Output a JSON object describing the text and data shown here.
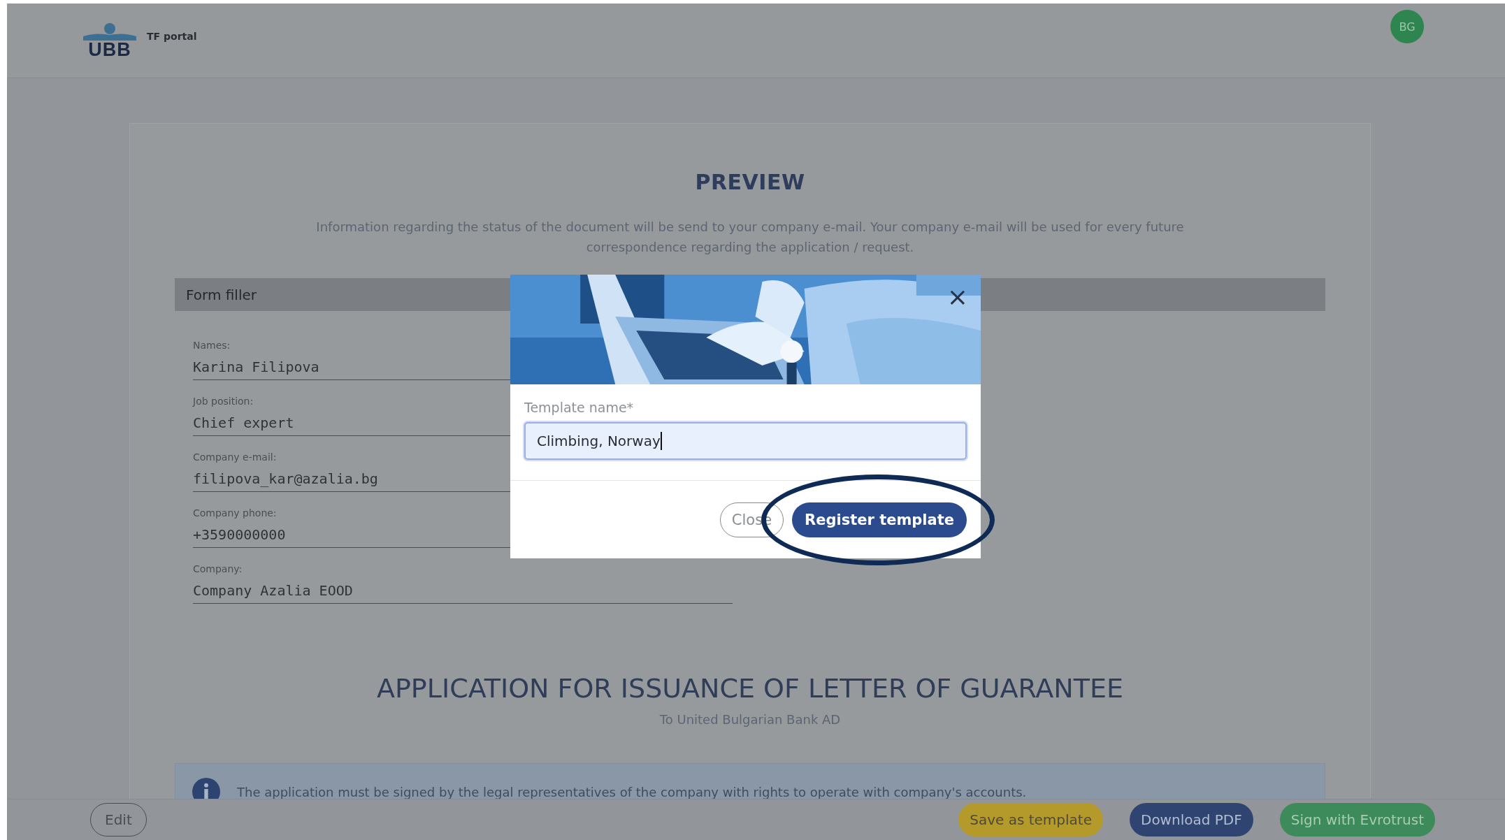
{
  "header": {
    "logo_text": "UBB",
    "portal_name": "TF portal",
    "avatar": "BG"
  },
  "preview": {
    "title": "PREVIEW",
    "notice": "Information regarding the status of the document will be send to your company e-mail. Your company e-mail will be used for every future correspondence regarding the application / request."
  },
  "form_filler": {
    "title": "Form filler",
    "fields": [
      {
        "label": "Names:",
        "value": "Karina Filipova"
      },
      {
        "label": "Job position:",
        "value": "Chief expert"
      },
      {
        "label": "Company e-mail:",
        "value": "filipova_kar@azalia.bg"
      },
      {
        "label": "Company phone:",
        "value": "+3590000000"
      },
      {
        "label": "Company:",
        "value": "Company Azalia EOOD"
      }
    ]
  },
  "application": {
    "title": "APPLICATION FOR ISSUANCE OF LETTER OF GUARANTEE",
    "subtitle": "To United Bulgarian Bank AD",
    "info": "The application must be signed by the legal representatives of the company with rights to operate with company's accounts."
  },
  "footer": {
    "left_button": "Edit",
    "buttons": [
      {
        "label": "Save as template",
        "kind": "warning"
      },
      {
        "label": "Download PDF",
        "kind": "primary"
      },
      {
        "label": "Sign with Evrotrust",
        "kind": "success"
      }
    ]
  },
  "modal": {
    "close_icon": "×",
    "field_label": "Template name*",
    "field_value": "Climbing, Norway",
    "buttons": [
      {
        "label": "Close",
        "kind": "secondary",
        "highlighted": false
      },
      {
        "label": "Register template",
        "kind": "primary",
        "highlighted": true
      }
    ]
  }
}
